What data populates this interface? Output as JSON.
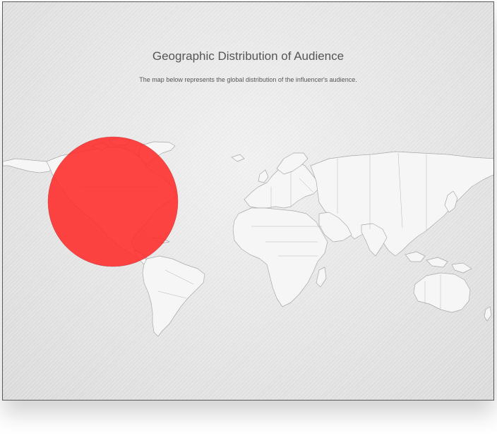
{
  "header": {
    "title": "Geographic Distribution of Audience",
    "subtitle": "The map below represents the global distribution of the influencer's audience."
  },
  "map": {
    "projection": "world",
    "land_color": "#f6f6f6",
    "border_color": "#a9a9a9",
    "background_color": "#e3e3e3"
  },
  "markers": [
    {
      "region": "North America",
      "color": "#ff2a2a",
      "share": 1.0
    }
  ]
}
